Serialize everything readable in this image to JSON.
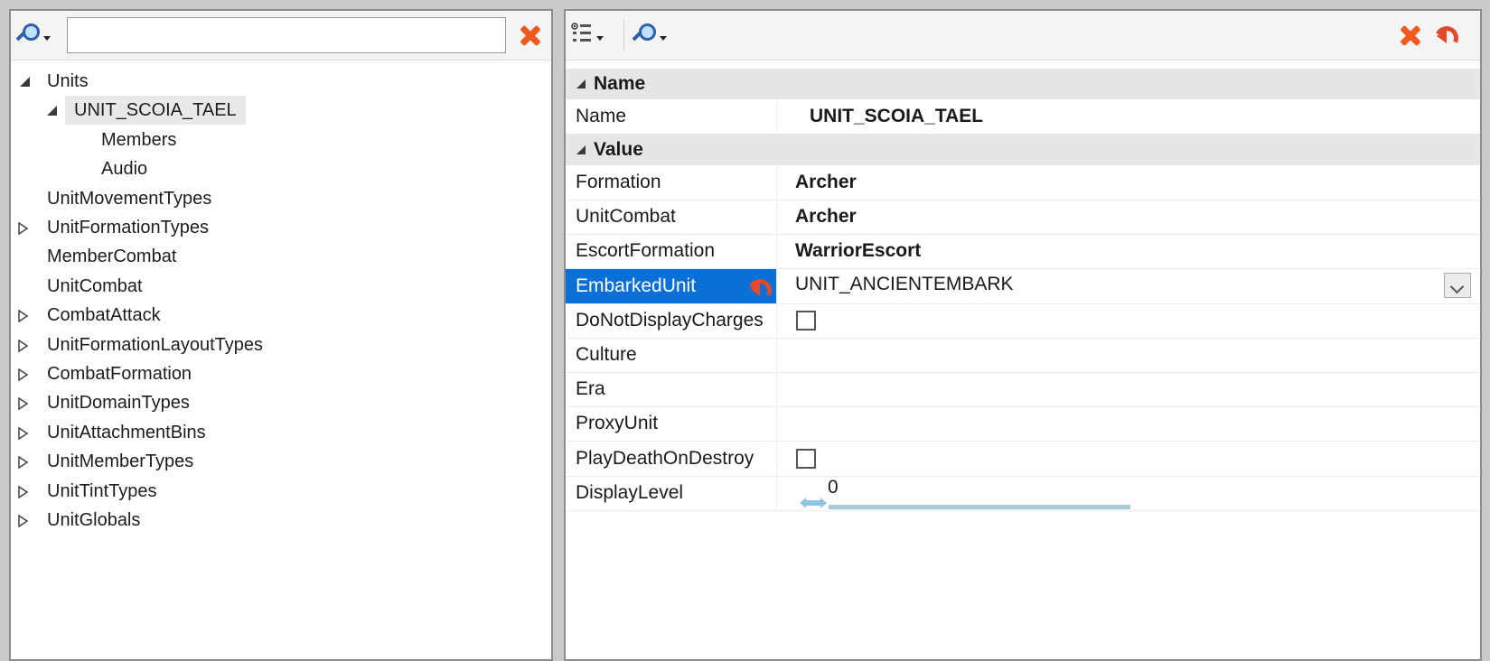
{
  "left_panel": {
    "search": {
      "value": "",
      "placeholder": ""
    },
    "tree": [
      {
        "label": "Units",
        "expander": "open",
        "level": 0
      },
      {
        "label": "UNIT_SCOIA_TAEL",
        "expander": "open",
        "level": 1,
        "selected": true
      },
      {
        "label": "Members",
        "expander": "none",
        "level": 2
      },
      {
        "label": "Audio",
        "expander": "none",
        "level": 2
      },
      {
        "label": "UnitMovementTypes",
        "expander": "none",
        "level": 0
      },
      {
        "label": "UnitFormationTypes",
        "expander": "closed",
        "level": 0
      },
      {
        "label": "MemberCombat",
        "expander": "none",
        "level": 0
      },
      {
        "label": "UnitCombat",
        "expander": "none",
        "level": 0
      },
      {
        "label": "CombatAttack",
        "expander": "closed",
        "level": 0
      },
      {
        "label": "UnitFormationLayoutTypes",
        "expander": "closed",
        "level": 0
      },
      {
        "label": "CombatFormation",
        "expander": "closed",
        "level": 0
      },
      {
        "label": "UnitDomainTypes",
        "expander": "closed",
        "level": 0
      },
      {
        "label": "UnitAttachmentBins",
        "expander": "closed",
        "level": 0
      },
      {
        "label": "UnitMemberTypes",
        "expander": "closed",
        "level": 0
      },
      {
        "label": "UnitTintTypes",
        "expander": "closed",
        "level": 0
      },
      {
        "label": "UnitGlobals",
        "expander": "closed",
        "level": 0
      }
    ]
  },
  "right_panel": {
    "categories": {
      "name": "Name",
      "value": "Value"
    },
    "name_row": {
      "label": "Name",
      "value": "UNIT_SCOIA_TAEL"
    },
    "rows": [
      {
        "label": "Formation",
        "value": "Archer",
        "type": "text-bold"
      },
      {
        "label": "UnitCombat",
        "value": "Archer",
        "type": "text-bold"
      },
      {
        "label": "EscortFormation",
        "value": "WarriorEscort",
        "type": "text-bold"
      },
      {
        "label": "EmbarkedUnit",
        "value": "UNIT_ANCIENTEMBARK",
        "type": "dropdown",
        "selected": true
      },
      {
        "label": "DoNotDisplayCharges",
        "value": "",
        "type": "checkbox",
        "checked": false
      },
      {
        "label": "Culture",
        "value": "",
        "type": "text"
      },
      {
        "label": "Era",
        "value": "",
        "type": "text"
      },
      {
        "label": "ProxyUnit",
        "value": "",
        "type": "text"
      },
      {
        "label": "PlayDeathOnDestroy",
        "value": "",
        "type": "checkbox",
        "checked": false
      },
      {
        "label": "DisplayLevel",
        "value": "0",
        "type": "numeric"
      }
    ]
  },
  "colors": {
    "selection": "#0a6fd6",
    "delete_icon": "#f05a1e",
    "category_bg": "#e6e6e6",
    "slider_track": "#a9cbd9"
  },
  "icons": {
    "search": "magnifier-icon",
    "delete": "red-x-icon",
    "revert": "undo-arrow-icon",
    "view": "property-view-icon"
  }
}
